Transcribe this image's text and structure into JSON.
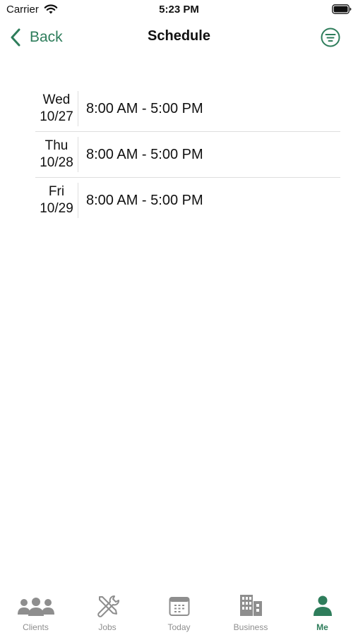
{
  "status_bar": {
    "carrier": "Carrier",
    "time": "5:23 PM"
  },
  "nav": {
    "back_label": "Back",
    "title": "Schedule"
  },
  "schedule": [
    {
      "weekday": "Wed",
      "date": "10/27",
      "hours": "8:00 AM - 5:00 PM"
    },
    {
      "weekday": "Thu",
      "date": "10/28",
      "hours": "8:00 AM - 5:00 PM"
    },
    {
      "weekday": "Fri",
      "date": "10/29",
      "hours": "8:00 AM - 5:00 PM"
    }
  ],
  "tabs": [
    {
      "label": "Clients",
      "icon": "people-icon",
      "active": false
    },
    {
      "label": "Jobs",
      "icon": "tools-icon",
      "active": false
    },
    {
      "label": "Today",
      "icon": "calendar-icon",
      "active": false
    },
    {
      "label": "Business",
      "icon": "building-icon",
      "active": false
    },
    {
      "label": "Me",
      "icon": "person-icon",
      "active": true
    }
  ],
  "colors": {
    "accent": "#2e7d5b",
    "inactive": "#8e8e8e"
  }
}
